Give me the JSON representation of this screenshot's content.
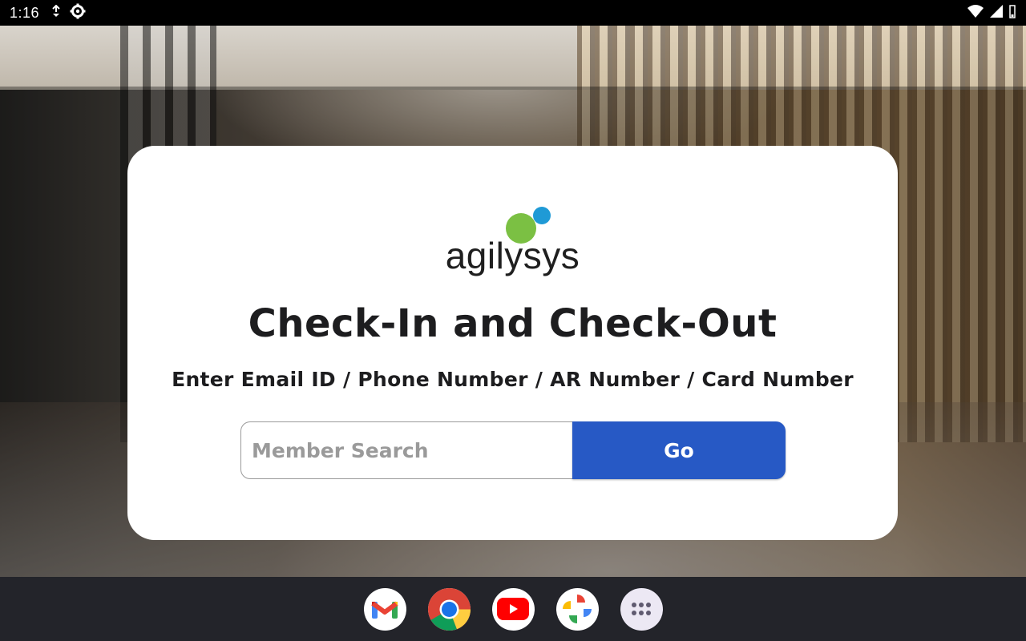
{
  "status_bar": {
    "time": "1:16"
  },
  "brand": {
    "logo_text": "agilysys",
    "colors": {
      "green": "#7bc043",
      "blue": "#1f9ad6"
    }
  },
  "card": {
    "title": "Check-In and Check-Out",
    "subtitle": "Enter Email ID / Phone Number / AR Number / Card Number",
    "search": {
      "placeholder": "Member Search",
      "value": ""
    },
    "go_label": "Go",
    "accent": "#2759c5"
  },
  "taskbar": {
    "apps": [
      {
        "icon": "gmail-icon"
      },
      {
        "icon": "chrome-icon"
      },
      {
        "icon": "youtube-icon"
      },
      {
        "icon": "photos-icon"
      },
      {
        "icon": "app-drawer-icon"
      }
    ]
  }
}
